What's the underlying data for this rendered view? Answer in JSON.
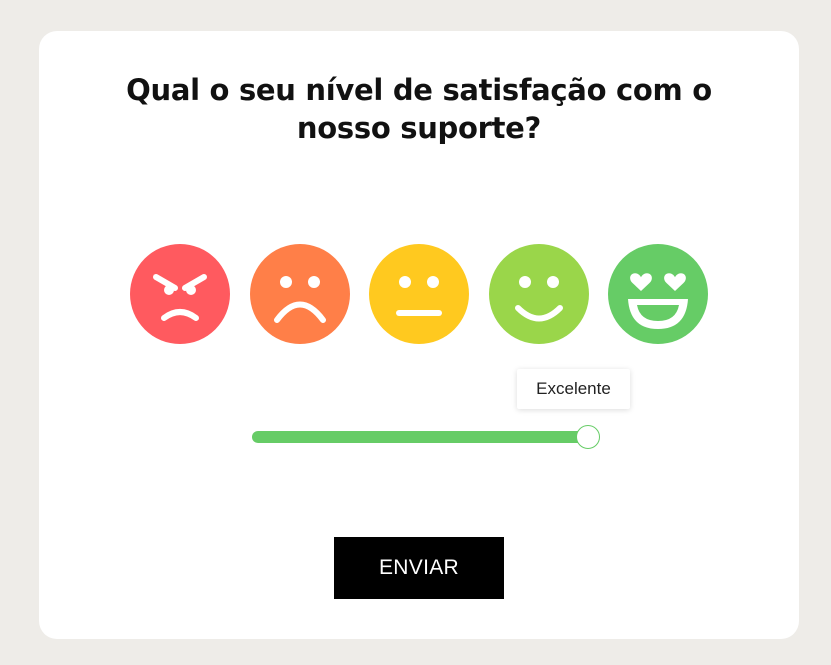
{
  "survey": {
    "question": "Qual o seu nível de satisfação com o nosso suporte?",
    "selected_label": "Excelente",
    "submit_label": "ENVIAR"
  },
  "rating": {
    "min": 1,
    "max": 5,
    "value": 5
  },
  "emojis": [
    {
      "name": "angry-face-icon",
      "color": "#ff5a5f"
    },
    {
      "name": "sad-face-icon",
      "color": "#ff7f48"
    },
    {
      "name": "neutral-face-icon",
      "color": "#ffc91f"
    },
    {
      "name": "smile-face-icon",
      "color": "#9ad64a"
    },
    {
      "name": "heart-eyes-face-icon",
      "color": "#66cc66"
    }
  ],
  "colors": {
    "page_background": "#eeece8",
    "card_background": "#ffffff",
    "accent": "#66cc66",
    "button_background": "#000000",
    "button_text": "#ffffff"
  }
}
